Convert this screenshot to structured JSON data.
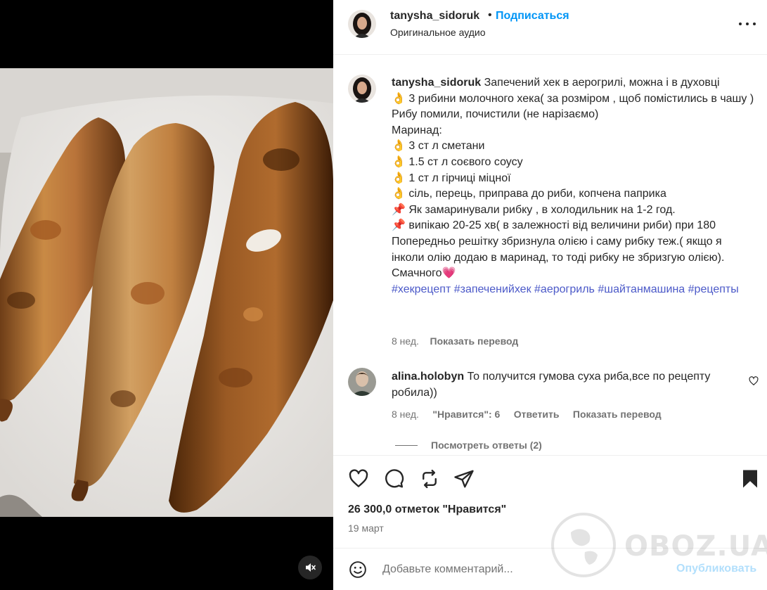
{
  "post": {
    "username": "tanysha_sidoruk",
    "separator": "•",
    "follow_label": "Подписаться",
    "audio": "Оригинальное аудио"
  },
  "caption": {
    "username": "tanysha_sidoruk",
    "first_line": "Запечений хек в аерогрилі, можна і в духовці",
    "lines": [
      "👌 3 рибини молочного хека( за розміром , щоб помістились в чашу )",
      "Рибу помили, почистили (не нарізаємо)",
      "Маринад:",
      "👌 3 ст л сметани",
      "👌 1.5 ст л соєвого соусу",
      "👌 1 ст л гірчиці міцної",
      "👌 сіль, перець, приправа до риби, копчена паприка",
      "📌 Як замаринували рибку , в холодильник на 1-2 год.",
      "📌 випікаю 20-25 хв( в залежності від величини риби) при 180",
      "Попередньо решітку збризнула олією і саму рибку теж.( якщо я інколи олію додаю в маринад, то тоді рибку не збризгую олією).",
      "Смачного💗"
    ],
    "hashtags": [
      "#хекрецепт",
      "#запеченийхек",
      "#аерогриль",
      "#шайтанмашина",
      "#рецепты"
    ],
    "time": "8 нед.",
    "translate": "Показать перевод"
  },
  "comment": {
    "username": "alina.holobyn",
    "text": "То получится гумова суха риба,все по рецепту робила))",
    "time": "8 нед.",
    "likes": "\"Нравится\": 6",
    "reply": "Ответить",
    "translate": "Показать перевод",
    "view_replies": "Посмотреть ответы (2)"
  },
  "stats": {
    "likes": "26 300,0 отметок \"Нравится\"",
    "date": "19 март"
  },
  "composer": {
    "placeholder": "Добавьте комментарий...",
    "publish": "Опубликовать"
  },
  "watermark": "OBOZ.UA",
  "icons": [
    "heart-icon",
    "comment-icon",
    "repost-icon",
    "share-icon",
    "bookmark-icon",
    "emoji-icon",
    "mute-icon",
    "more-icon"
  ]
}
